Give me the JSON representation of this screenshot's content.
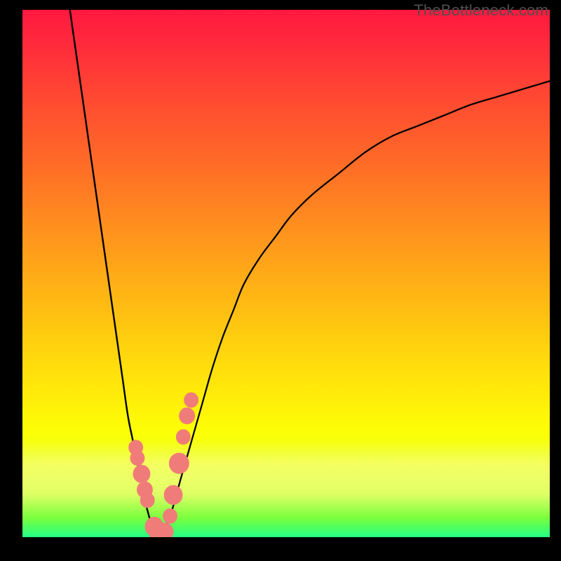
{
  "watermark": "TheBottleneck.com",
  "colors": {
    "gradient": [
      "#FF183F",
      "#FF2C3B",
      "#FF4134",
      "#FF552E",
      "#FF6B27",
      "#FF8022",
      "#FF951D",
      "#FFAA17",
      "#FFBE12",
      "#FFD30E",
      "#FFE90A",
      "#FDFF06",
      "#D9FF27",
      "#7CFF3D",
      "#2FFF7C"
    ],
    "green_band_top": 0.815,
    "stroke": "#000000",
    "dots_fill": "#F07C7A",
    "dots_stroke": "#F07C7A"
  },
  "chart_data": {
    "type": "line",
    "title": "",
    "xlabel": "",
    "ylabel": "",
    "xlim": [
      0,
      100
    ],
    "ylim": [
      0,
      100
    ],
    "series": [
      {
        "name": "falling-curve",
        "type": "curve",
        "x": [
          9,
          10,
          11,
          12,
          13,
          14,
          15,
          16,
          17,
          18,
          19,
          20,
          21,
          22,
          23,
          24,
          25,
          26
        ],
        "y": [
          100,
          93,
          86,
          79,
          72,
          65,
          58,
          51,
          44,
          37,
          30,
          23,
          18,
          13,
          8,
          4,
          1,
          0
        ]
      },
      {
        "name": "rising-curve",
        "type": "curve",
        "x": [
          26,
          28,
          30,
          32,
          34,
          36,
          38,
          40,
          42,
          45,
          48,
          51,
          55,
          60,
          65,
          70,
          75,
          80,
          85,
          90,
          95,
          100
        ],
        "y": [
          0,
          4,
          11,
          18,
          25,
          32,
          38,
          43,
          48,
          53,
          57,
          61,
          65,
          69,
          73,
          76,
          78,
          80,
          82,
          83.5,
          85,
          86.5
        ]
      },
      {
        "name": "dots-left",
        "type": "scatter",
        "x": [
          21.5,
          21.8,
          22.6,
          23.2,
          23.7,
          25.0,
          26.0
        ],
        "y": [
          17,
          15,
          12,
          9,
          7,
          2,
          0.5
        ],
        "size": [
          10,
          10,
          12,
          11,
          10,
          13,
          14
        ]
      },
      {
        "name": "dots-right",
        "type": "scatter",
        "x": [
          27.0,
          28.0,
          28.6,
          29.7,
          30.5,
          31.2,
          32.0
        ],
        "y": [
          1,
          4,
          8,
          14,
          19,
          23,
          26
        ],
        "size": [
          12,
          10,
          13,
          14,
          10,
          11,
          10
        ]
      }
    ]
  }
}
